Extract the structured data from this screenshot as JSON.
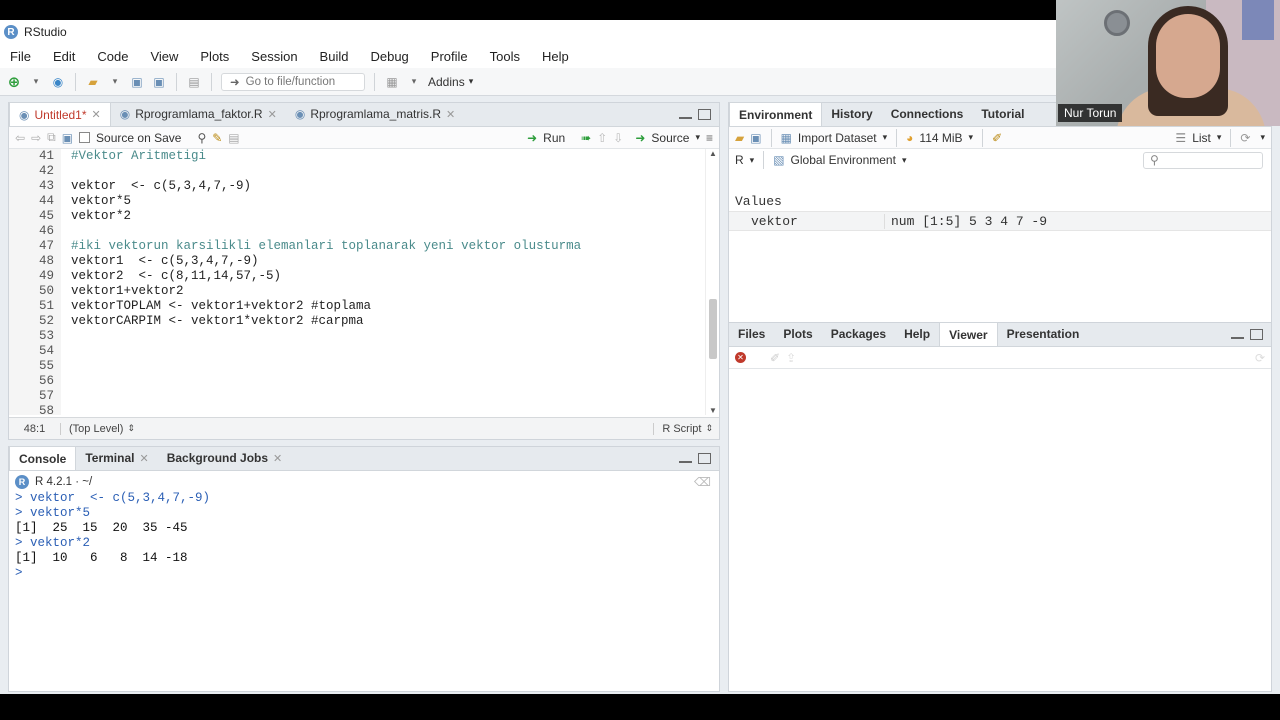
{
  "window": {
    "title": "RStudio"
  },
  "menu": [
    "File",
    "Edit",
    "Code",
    "View",
    "Plots",
    "Session",
    "Build",
    "Debug",
    "Profile",
    "Tools",
    "Help"
  ],
  "toolbar": {
    "goto_placeholder": "Go to file/function",
    "addins": "Addins"
  },
  "editor": {
    "tabs": [
      {
        "label": "Untitled1*",
        "active": true
      },
      {
        "label": "Rprogramlama_faktor.R",
        "active": false
      },
      {
        "label": "Rprogramlama_matris.R",
        "active": false
      }
    ],
    "source_on_save": "Source on Save",
    "run": "Run",
    "source": "Source",
    "lines": [
      {
        "n": "41",
        "t": "#Vektor Aritmetigi",
        "c": true
      },
      {
        "n": "42",
        "t": "",
        "c": false
      },
      {
        "n": "43",
        "t": "vektor  <- c(5,3,4,7,-9)",
        "c": false
      },
      {
        "n": "44",
        "t": "vektor*5",
        "c": false
      },
      {
        "n": "45",
        "t": "vektor*2",
        "c": false
      },
      {
        "n": "46",
        "t": "",
        "c": false
      },
      {
        "n": "47",
        "t": "#iki vektorun karsilikli elemanlari toplanarak yeni vektor olusturma",
        "c": true
      },
      {
        "n": "48",
        "t": "vektor1  <- c(5,3,4,7,-9)",
        "c": false
      },
      {
        "n": "49",
        "t": "vektor2  <- c(8,11,14,57,-5)",
        "c": false
      },
      {
        "n": "50",
        "t": "vektor1+vektor2",
        "c": false
      },
      {
        "n": "51",
        "t": "vektorTOPLAM <- vektor1+vektor2 #toplama",
        "c": false
      },
      {
        "n": "52",
        "t": "vektorCARPIM <- vektor1*vektor2 #carpma",
        "c": false
      },
      {
        "n": "53",
        "t": "",
        "c": false
      },
      {
        "n": "54",
        "t": "",
        "c": false
      },
      {
        "n": "55",
        "t": "",
        "c": false
      },
      {
        "n": "56",
        "t": "",
        "c": false
      },
      {
        "n": "57",
        "t": "",
        "c": false
      },
      {
        "n": "58",
        "t": "",
        "c": false
      }
    ],
    "status_pos": "48:1",
    "status_scope": "(Top Level)",
    "status_type": "R Script"
  },
  "console": {
    "tabs": [
      "Console",
      "Terminal",
      "Background Jobs"
    ],
    "version": "R 4.2.1 · ~/",
    "lines": [
      {
        "p": ">",
        "t": " vektor  <- c(5,3,4,7,-9)",
        "kind": "cmd"
      },
      {
        "p": ">",
        "t": " vektor*5",
        "kind": "cmd"
      },
      {
        "p": "",
        "t": "[1]  25  15  20  35 -45",
        "kind": "out"
      },
      {
        "p": ">",
        "t": " vektor*2",
        "kind": "cmd"
      },
      {
        "p": "",
        "t": "[1]  10   6   8  14 -18",
        "kind": "out"
      },
      {
        "p": ">",
        "t": " ",
        "kind": "cmd"
      }
    ]
  },
  "environment": {
    "tabs": [
      "Environment",
      "History",
      "Connections",
      "Tutorial"
    ],
    "import_dataset": "Import Dataset",
    "memory": "114 MiB",
    "list_view": "List",
    "lang": "R",
    "scope": "Global Environment",
    "section": "Values",
    "rows": [
      {
        "name": "vektor",
        "value": "num [1:5] 5 3 4 7 -9"
      }
    ]
  },
  "files": {
    "tabs": [
      "Files",
      "Plots",
      "Packages",
      "Help",
      "Viewer",
      "Presentation"
    ]
  },
  "webcam": {
    "name": "Nur Torun"
  }
}
